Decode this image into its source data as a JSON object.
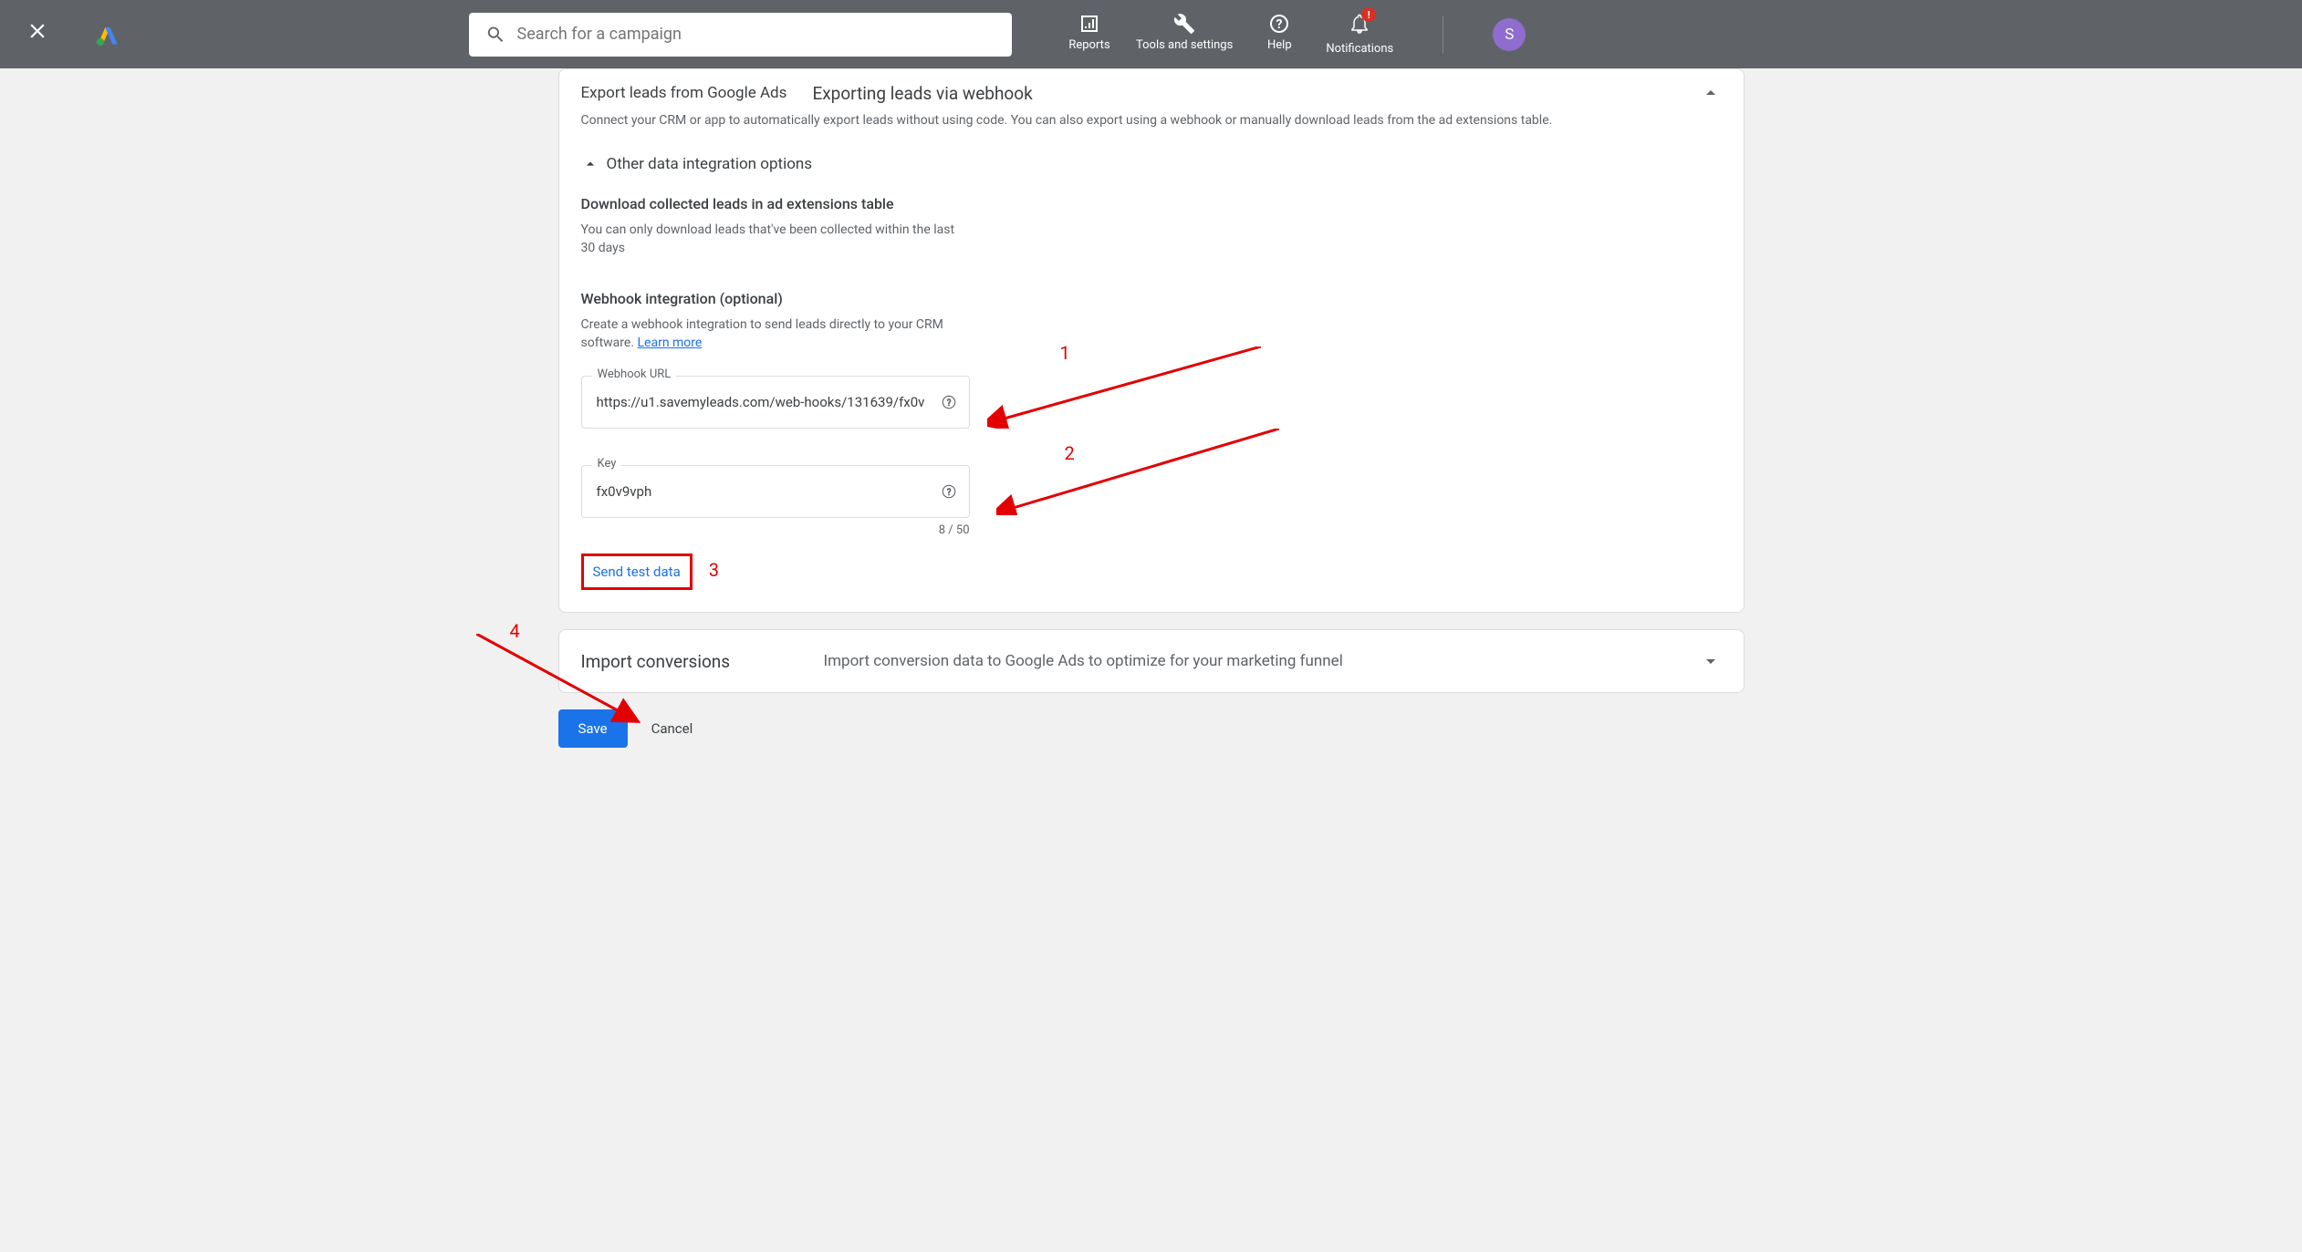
{
  "header": {
    "search_placeholder": "Search for a campaign",
    "nav": {
      "reports": "Reports",
      "tools": "Tools and settings",
      "help": "Help",
      "notifications": "Notifications",
      "badge": "!"
    },
    "avatar_letter": "S"
  },
  "export_card": {
    "title": "Export leads from Google Ads",
    "subtitle": "Exporting leads via webhook",
    "description": "Connect your CRM or app to automatically export leads without using code. You can also export using a webhook or manually download leads from the ad extensions table.",
    "collapse_title": "Other data integration options",
    "download_section": {
      "title": "Download collected leads in ad extensions table",
      "desc": "You can only download leads that've been collected within the last 30 days"
    },
    "webhook_section": {
      "title": "Webhook integration (optional)",
      "desc_prefix": "Create a webhook integration to send leads directly to your CRM software. ",
      "learn_more": "Learn more",
      "url_label": "Webhook URL",
      "url_value": "https://u1.savemyleads.com/web-hooks/131639/fx0v",
      "key_label": "Key",
      "key_value": "fx0v9vph",
      "char_count": "8 / 50",
      "send_test": "Send test data"
    }
  },
  "import_card": {
    "title": "Import conversions",
    "desc": "Import conversion data to Google Ads to optimize for your marketing funnel"
  },
  "footer": {
    "save": "Save",
    "cancel": "Cancel"
  },
  "annotations": {
    "n1": "1",
    "n2": "2",
    "n3": "3",
    "n4": "4"
  }
}
